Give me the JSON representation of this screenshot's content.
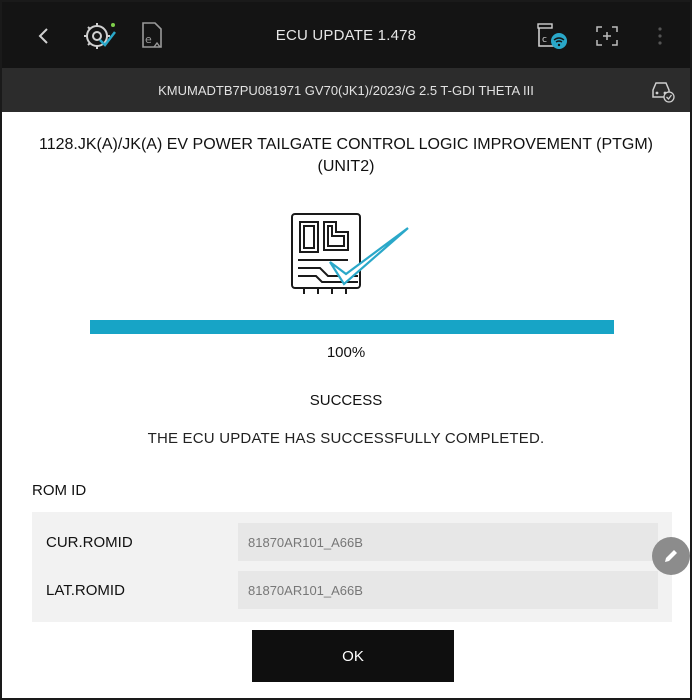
{
  "header": {
    "title": "ECU UPDATE 1.478",
    "icons": [
      "back-chevron-icon",
      "gear-check-icon",
      "export-document-icon",
      "vci-wifi-icon",
      "screenshot-icon",
      "more-vertical-icon"
    ]
  },
  "vehicle_bar": {
    "text": "KMUMADTB7PU081971  GV70(JK1)/2023/G 2.5 T-GDI THETA III",
    "icon": "car-diagnostic-icon"
  },
  "update": {
    "title": "1128.JK(A)/JK(A) EV POWER TAILGATE CONTROL LOGIC IMPROVEMENT (PTGM) (UNIT2)",
    "progress_fraction": 1.0,
    "percent_label": "100%",
    "status": "SUCCESS",
    "message": "THE ECU UPDATE HAS SUCCESSFULLY COMPLETED."
  },
  "rom": {
    "section_label": "ROM ID",
    "rows": [
      {
        "key": "CUR.ROMID",
        "value": "81870AR101_A66B"
      },
      {
        "key": "LAT.ROMID",
        "value": "81870AR101_A66B"
      }
    ]
  },
  "actions": {
    "ok_label": "OK"
  },
  "colors": {
    "topbar": "#141414",
    "subbar": "#2c2c2c",
    "progress": "#17a4c6",
    "check": "#2aa8c9"
  }
}
